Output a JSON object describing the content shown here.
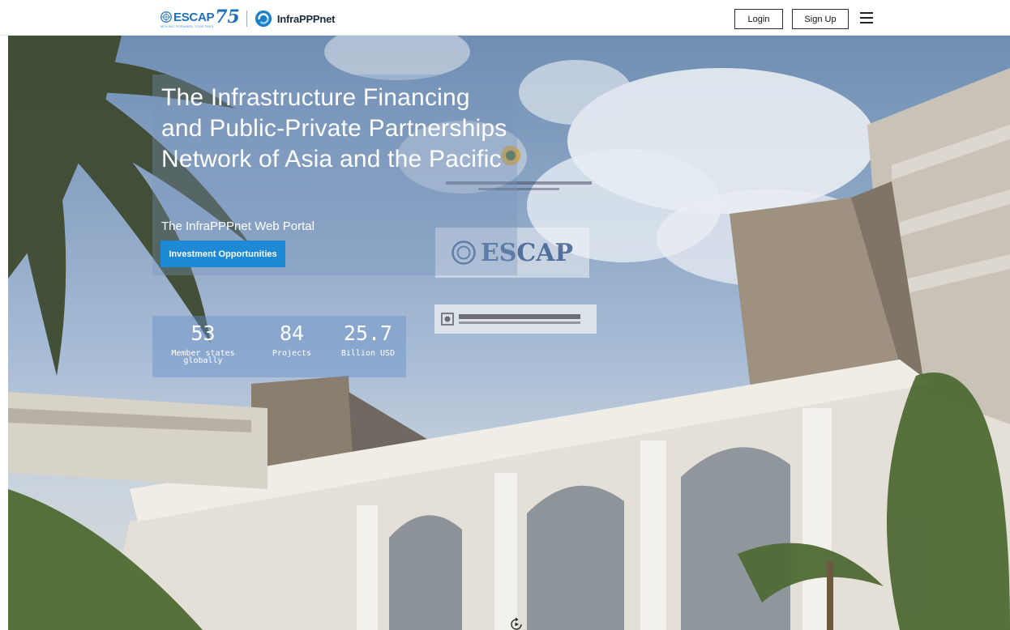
{
  "header": {
    "brand": {
      "escap_name": "ESCAP",
      "escap_anniversary": "75",
      "escap_tagline": "MOVING FORWARD TOGETHER",
      "portal_name": "InfraPPPnet"
    },
    "login_label": "Login",
    "signup_label": "Sign Up",
    "menu_icon": "hamburger-icon"
  },
  "hero": {
    "title": "The Infrastructure Financing and Public-Private Partnerships Network of Asia and the Pacific",
    "subtitle": "The InfraPPPnet Web Portal",
    "cta_label": "Investment Opportunities",
    "stats": [
      {
        "value": "53",
        "label": "Member states globally"
      },
      {
        "value": "84",
        "label": "Projects"
      },
      {
        "value": "25.7",
        "label": "Billion USD"
      }
    ],
    "partner_logo_text": "ESCAP",
    "replay_icon": "replay-icon"
  },
  "colors": {
    "brand_blue": "#1d6fb8",
    "cta_blue": "#1e8ad6",
    "header_bg": "#ffffff"
  }
}
